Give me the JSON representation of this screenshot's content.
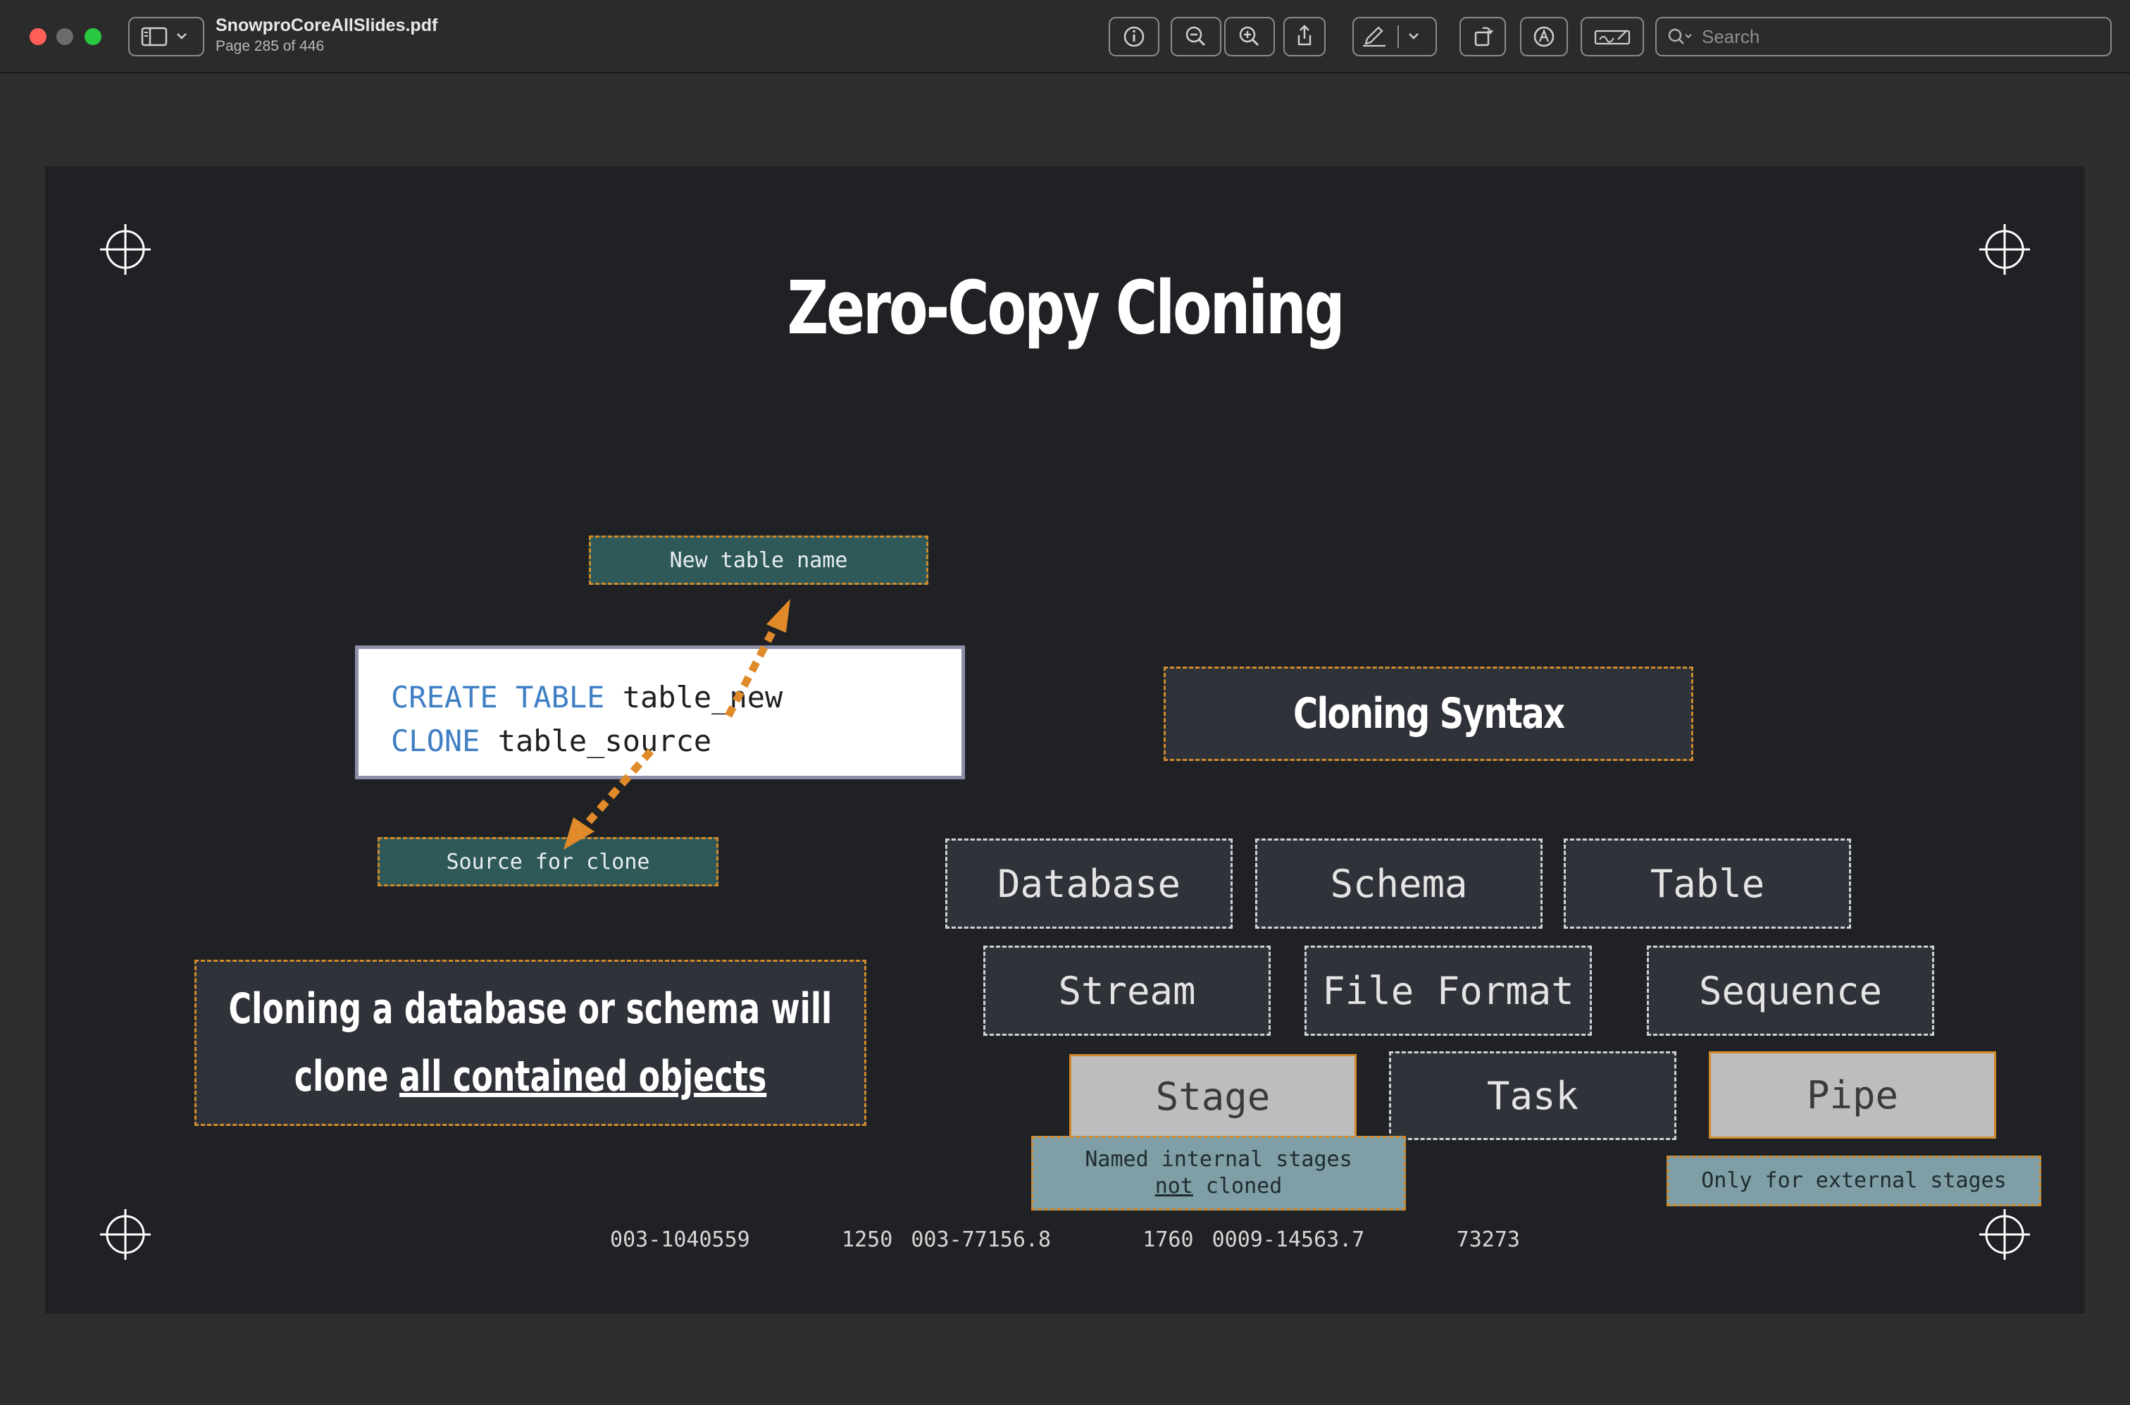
{
  "window": {
    "title": "SnowproCoreAllSlides.pdf",
    "subtitle": "Page 285 of 446",
    "search_placeholder": "Search"
  },
  "toolbar": {
    "icons": [
      "sidebar-icon",
      "chevron-down-icon",
      "info-icon",
      "zoom-out-icon",
      "zoom-in-icon",
      "share-icon",
      "markup-pen-icon",
      "chevron-down-icon",
      "rotate-icon",
      "annotate-icon",
      "signature-icon",
      "search-icon"
    ]
  },
  "slide": {
    "title": "Zero-Copy Cloning",
    "new_table_tag": "New table name",
    "source_tag": "Source for clone",
    "code": {
      "line1_kw": "CREATE TABLE",
      "line1_rest": " table_new",
      "line2_kw": "CLONE",
      "line2_rest": " table_source"
    },
    "syntax_header": "Cloning Syntax",
    "objects": {
      "database": "Database",
      "schema": "Schema",
      "table": "Table",
      "stream": "Stream",
      "file_format": "File Format",
      "sequence": "Sequence",
      "stage": "Stage",
      "task": "Task",
      "pipe": "Pipe"
    },
    "notes": {
      "stage_line1": "Named internal stages",
      "stage_not": "not",
      "stage_line2_rest": " cloned",
      "pipe": "Only for external stages"
    },
    "callout": {
      "line1": "Cloning a database or schema will",
      "line2_prefix": "clone ",
      "line2_underlined": "all contained objects"
    },
    "footer": "003-1040559     1250 003-77156.8     1760 0009-14563.7     73273"
  },
  "colors": {
    "slide_bg": "#202124",
    "accent_orange": "#d08a2a",
    "teal_tag": "#2f5959",
    "keyword_blue": "#3f7fc4"
  }
}
